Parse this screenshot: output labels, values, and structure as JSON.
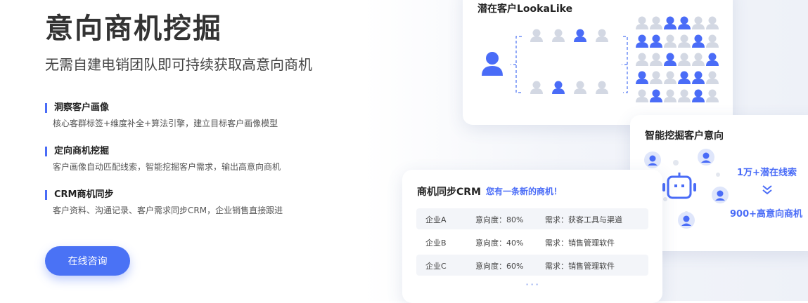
{
  "hero": {
    "title": "意向商机挖掘",
    "subtitle": "无需自建电销团队即可持续获取高意向商机",
    "cta_label": "在线咨询"
  },
  "features": [
    {
      "title": "洞察客户画像",
      "desc": "核心客群标签+维度补全+算法引擎，建立目标客户画像模型"
    },
    {
      "title": "定向商机挖掘",
      "desc": "客户画像自动匹配线索，智能挖掘客户需求，输出高意向商机"
    },
    {
      "title": "CRM商机同步",
      "desc": "客户资料、沟通记录、客户需求同步CRM，企业销售直接跟进"
    }
  ],
  "lookalike_card": {
    "title": "潜在客户LookaLike"
  },
  "intent_card": {
    "title": "智能挖掘客户意向",
    "stat1": "1万+潜在线索",
    "stat2": "900+高意向商机"
  },
  "crm_card": {
    "title": "商机同步CRM",
    "notice": "您有一条新的商机！",
    "more": "···",
    "rows": [
      {
        "company": "企业A",
        "intent": "意向度：80%",
        "need": "需求：获客工具与渠道"
      },
      {
        "company": "企业B",
        "intent": "意向度：40%",
        "need": "需求：销售管理软件"
      },
      {
        "company": "企业C",
        "intent": "意向度：60%",
        "need": "需求：销售管理软件"
      }
    ]
  },
  "colors": {
    "accent": "#4a6cf7",
    "person_gray": "#d3d8e3",
    "person_blue": "#4a6cf7"
  },
  "icons": [
    "person-icon",
    "robot-icon",
    "double-chevron-down-icon",
    "avatar-icon"
  ]
}
